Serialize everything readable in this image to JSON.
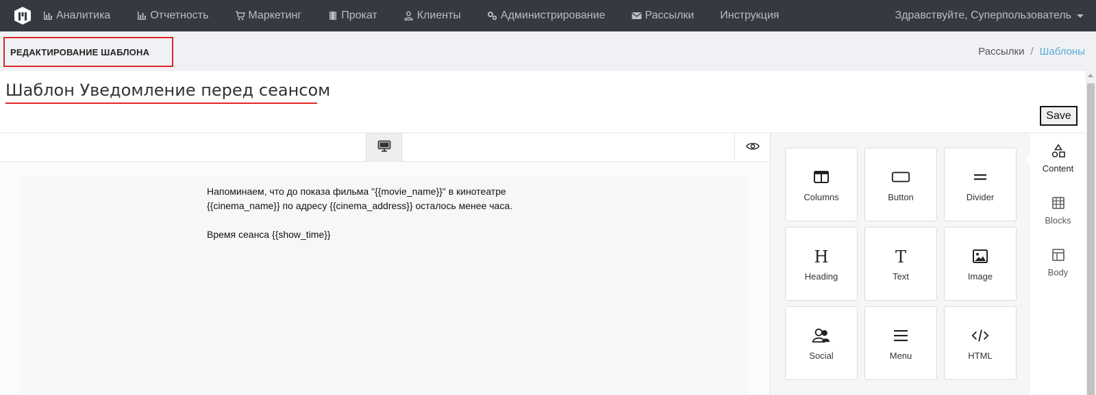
{
  "nav": {
    "logo": "logo-icon",
    "items": [
      {
        "label": "Аналитика",
        "icon": "bar-chart-icon"
      },
      {
        "label": "Отчетность",
        "icon": "bar-chart-icon"
      },
      {
        "label": "Маркетинг",
        "icon": "cart-icon"
      },
      {
        "label": "Прокат",
        "icon": "film-icon"
      },
      {
        "label": "Клиенты",
        "icon": "user-icon"
      },
      {
        "label": "Администрирование",
        "icon": "cogs-icon"
      },
      {
        "label": "Рассылки",
        "icon": "envelope-icon"
      },
      {
        "label": "Инструкция",
        "icon": ""
      }
    ],
    "user_greeting": "Здравствуйте, Суперпользователь"
  },
  "subheader": {
    "page_title": "РЕДАКТИРОВАНИЕ ШАБЛОНА",
    "breadcrumb": [
      "Рассылки",
      "Шаблоны"
    ],
    "separator": "/"
  },
  "template": {
    "title": "Шаблон Уведомление перед сеансом",
    "save_label": "Save"
  },
  "editor": {
    "toolbar": {
      "desktop_icon": "desktop-icon",
      "preview_icon": "eye-icon"
    },
    "content_lines": [
      "Напоминаем, что до показа фильма \"{{movie_name}}\" в кинотеатре",
      "{{cinema_name}} по адресу {{cinema_address}} осталось менее часа.",
      "Время сеанса {{show_time}}"
    ]
  },
  "tools": [
    {
      "label": "Columns",
      "icon": "columns-icon"
    },
    {
      "label": "Button",
      "icon": "button-icon"
    },
    {
      "label": "Divider",
      "icon": "divider-icon"
    },
    {
      "label": "Heading",
      "icon": "heading-icon"
    },
    {
      "label": "Text",
      "icon": "text-icon"
    },
    {
      "label": "Image",
      "icon": "image-icon"
    },
    {
      "label": "Social",
      "icon": "social-icon"
    },
    {
      "label": "Menu",
      "icon": "menu-icon"
    },
    {
      "label": "HTML",
      "icon": "code-icon"
    }
  ],
  "side_tabs": [
    {
      "label": "Content",
      "icon": "shapes-icon",
      "active": true
    },
    {
      "label": "Blocks",
      "icon": "blocks-icon",
      "active": false
    },
    {
      "label": "Body",
      "icon": "body-layout-icon",
      "active": false
    }
  ],
  "colors": {
    "navbar": "#343a40",
    "highlight": "#e02424",
    "breadcrumb_active": "#5aaad8"
  }
}
